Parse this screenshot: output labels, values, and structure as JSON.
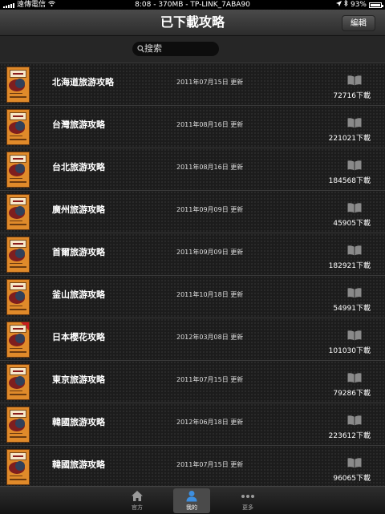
{
  "status": {
    "carrier": "遠傳電信",
    "center": "8:08 - 370MB - TP-LINK_7ABA90",
    "battery": "93%"
  },
  "nav": {
    "title": "已下載攻略",
    "edit_label": "編輯"
  },
  "search": {
    "placeholder": "搜索"
  },
  "items": [
    {
      "title": "北海道旅游攻略",
      "date": "2011年07月15日 更新",
      "downloads": "72716下載"
    },
    {
      "title": "台灣旅游攻略",
      "date": "2011年08月16日 更新",
      "downloads": "221021下載"
    },
    {
      "title": "台北旅游攻略",
      "date": "2011年08月16日 更新",
      "downloads": "184568下載"
    },
    {
      "title": "廣州旅游攻略",
      "date": "2011年09月09日 更新",
      "downloads": "45905下載"
    },
    {
      "title": "首爾旅游攻略",
      "date": "2011年09月09日 更新",
      "downloads": "182921下載"
    },
    {
      "title": "釜山旅游攻略",
      "date": "2011年10月18日 更新",
      "downloads": "54991下載"
    },
    {
      "title": "日本櫻花攻略",
      "date": "2012年03月08日 更新",
      "downloads": "101030下載"
    },
    {
      "title": "東京旅游攻略",
      "date": "2011年07月15日 更新",
      "downloads": "79286下載"
    },
    {
      "title": "韓國旅游攻略",
      "date": "2012年06月18日 更新",
      "downloads": "223612下載"
    },
    {
      "title": "韓國旅游攻略",
      "date": "2011年07月15日 更新",
      "downloads": "96065下載"
    }
  ],
  "tabs": [
    {
      "label": "官方",
      "icon": "home-icon",
      "active": false
    },
    {
      "label": "我的",
      "icon": "person-icon",
      "active": true
    },
    {
      "label": "更多",
      "icon": "more-icon",
      "active": false
    }
  ],
  "colors": {
    "background": "#1e1e1e",
    "cover": "#e08a2a",
    "active_tab": "#4a4a4a"
  }
}
